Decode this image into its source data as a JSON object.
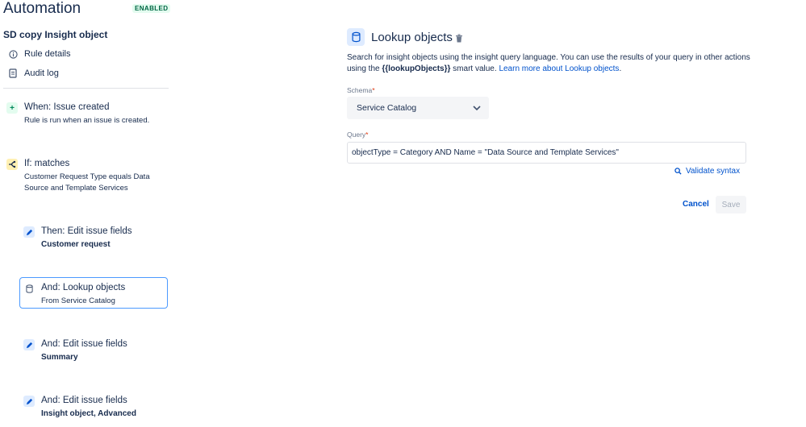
{
  "header": {
    "title": "Automation",
    "status": "ENABLED",
    "rule_name": "SD copy Insight object"
  },
  "nav": {
    "rule_details": "Rule details",
    "audit_log": "Audit log"
  },
  "steps": [
    {
      "title": "When: Issue created",
      "sub": "Rule is run when an issue is created."
    },
    {
      "title": "If: matches",
      "sub1": "Customer Request Type equals Data",
      "sub2": "Source and Template Services"
    },
    {
      "title": "Then: Edit issue fields",
      "bold": "Customer request"
    },
    {
      "title": "And: Lookup objects",
      "sub": "From Service Catalog"
    },
    {
      "title": "And: Edit issue fields",
      "bold": "Summary"
    },
    {
      "title": "And: Edit issue fields",
      "bold": "Insight object, Advanced"
    }
  ],
  "panel": {
    "title": "Lookup objects",
    "desc_line1": "Search for insight objects using the insight query language. You can use the results of your query in other actions",
    "desc_pre": "using the ",
    "desc_smart": "{{lookupObjects}}",
    "desc_mid": " smart value. ",
    "desc_link": "Learn more about Lookup objects",
    "desc_end": ".",
    "schema_label": "Schema",
    "schema_value": "Service Catalog",
    "query_label": "Query",
    "query_value": "objectType = Category AND Name = \"Data Source and Template Services\"",
    "validate_label": "Validate syntax",
    "cancel_label": "Cancel",
    "save_label": "Save"
  },
  "colors": {
    "accent": "#0052cc",
    "trigger": "#00875a",
    "condition": "#ffab00",
    "selected_border": "#4c9aff"
  }
}
